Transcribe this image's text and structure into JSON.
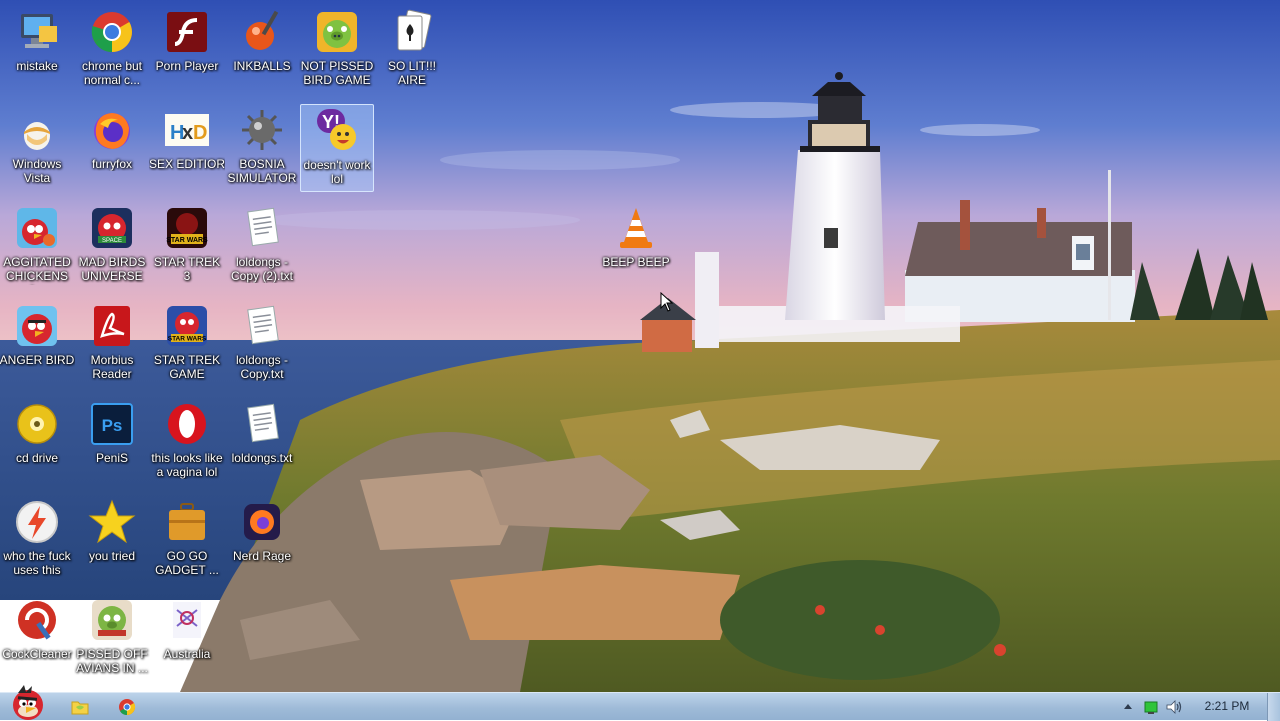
{
  "desktop": {
    "icons": [
      {
        "label": "mistake",
        "icon": "computer-icon"
      },
      {
        "label": "chrome but normal c...",
        "icon": "chrome-icon"
      },
      {
        "label": "Porn Player",
        "icon": "flash-player-icon"
      },
      {
        "label": "INKBALLS",
        "icon": "inkball-icon"
      },
      {
        "label": "NOT PISSED BIRD GAME",
        "icon": "green-pig-icon"
      },
      {
        "label": "SO LIT!!! AIRE",
        "icon": "solitaire-cards-icon"
      },
      {
        "label": "Windows Vista",
        "icon": "egg-icon"
      },
      {
        "label": "furryfox",
        "icon": "firefox-icon"
      },
      {
        "label": "SEX EDITIOR",
        "icon": "hxd-editor-icon"
      },
      {
        "label": "BOSNIA SIMULATOR",
        "icon": "mine-icon"
      },
      {
        "label": "doesn't work lol",
        "icon": "yahoo-messenger-icon"
      },
      {
        "label": "AGGITATED CHICKENS I...",
        "icon": "angry-bird-icon"
      },
      {
        "label": "MAD BIRDS UNIVERSE",
        "icon": "angry-birds-space-icon"
      },
      {
        "label": "STAR TREK 3",
        "icon": "star-wars-game-icon"
      },
      {
        "label": "loldongs - Copy (2).txt",
        "icon": "text-file-icon"
      },
      {
        "label": "BEEP BEEP",
        "icon": "vlc-cone-icon"
      },
      {
        "label": "ANGER BIRD",
        "icon": "angry-bird-icon"
      },
      {
        "label": "Morbius Reader",
        "icon": "adobe-reader-icon"
      },
      {
        "label": "STAR TREK GAME",
        "icon": "star-wars-game-icon"
      },
      {
        "label": "loldongs - Copy.txt",
        "icon": "text-file-icon"
      },
      {
        "label": "cd drive",
        "icon": "cd-drive-icon"
      },
      {
        "label": "PeniS",
        "icon": "photoshop-icon"
      },
      {
        "label": "this looks like a vagina lol",
        "icon": "opera-icon"
      },
      {
        "label": "loldongs.txt",
        "icon": "text-file-icon"
      },
      {
        "label": "who the fuck uses this",
        "icon": "winamp-bolt-icon"
      },
      {
        "label": "you tried",
        "icon": "star-icon"
      },
      {
        "label": "GO GO GADGET ...",
        "icon": "briefcase-icon"
      },
      {
        "label": "Nerd Rage",
        "icon": "firefox-dark-icon"
      },
      {
        "label": "CockCleaner",
        "icon": "ccleaner-icon"
      },
      {
        "label": "PISSED OFF AVIANS IN ...",
        "icon": "angry-birds-seasons-icon"
      },
      {
        "label": "Australia",
        "icon": "flag-icon"
      }
    ]
  },
  "taskbar": {
    "start_icon": "angry-bird-start-icon",
    "pinned": [
      {
        "name": "explorer",
        "icon": "folder-icon"
      },
      {
        "name": "chrome",
        "icon": "chrome-icon"
      }
    ],
    "tray": {
      "overflow_icon": "chevron-up-icon",
      "network_icon": "network-icon",
      "volume_icon": "volume-icon",
      "clock": "2:21 PM"
    }
  }
}
